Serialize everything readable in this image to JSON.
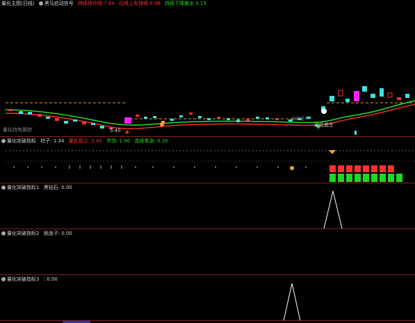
{
  "colors": {
    "background": "#000000",
    "separator": "#8a1f1f",
    "white_text": "#d8d8d8",
    "red": "#ff3030",
    "green": "#22d622",
    "orange": "#f0a030",
    "cyan": "#40e0e0",
    "magenta": "#ff20ff"
  },
  "main": {
    "title": "量化主图(日线)",
    "indicator": "黑马启动信号",
    "item1": "持续持仓线 7.64",
    "item2": "拉线上车持续 0.96",
    "item3": "持续下降撤出 0.15",
    "left_label": "量化持有跟踪",
    "price_low": "5.40",
    "right_label1": "破位逃生",
    "right_label2": "出货信号"
  },
  "panel1": {
    "title": "量化突破指标",
    "v1": "柱子: 1.34",
    "v2": "量化提示: 0.40",
    "v3": "市场: 1.00",
    "v4": "连续看涨: 0.20"
  },
  "panel2": {
    "title": "量化突破指标1",
    "v1": "黑钻石: 0.00"
  },
  "panel3": {
    "title": "量化突破指标2",
    "v1": "就涨子: 0.00"
  },
  "panel4": {
    "title": "量化突破指标3",
    "v1": ": 0.00"
  },
  "footer": {
    "tab": ""
  }
}
